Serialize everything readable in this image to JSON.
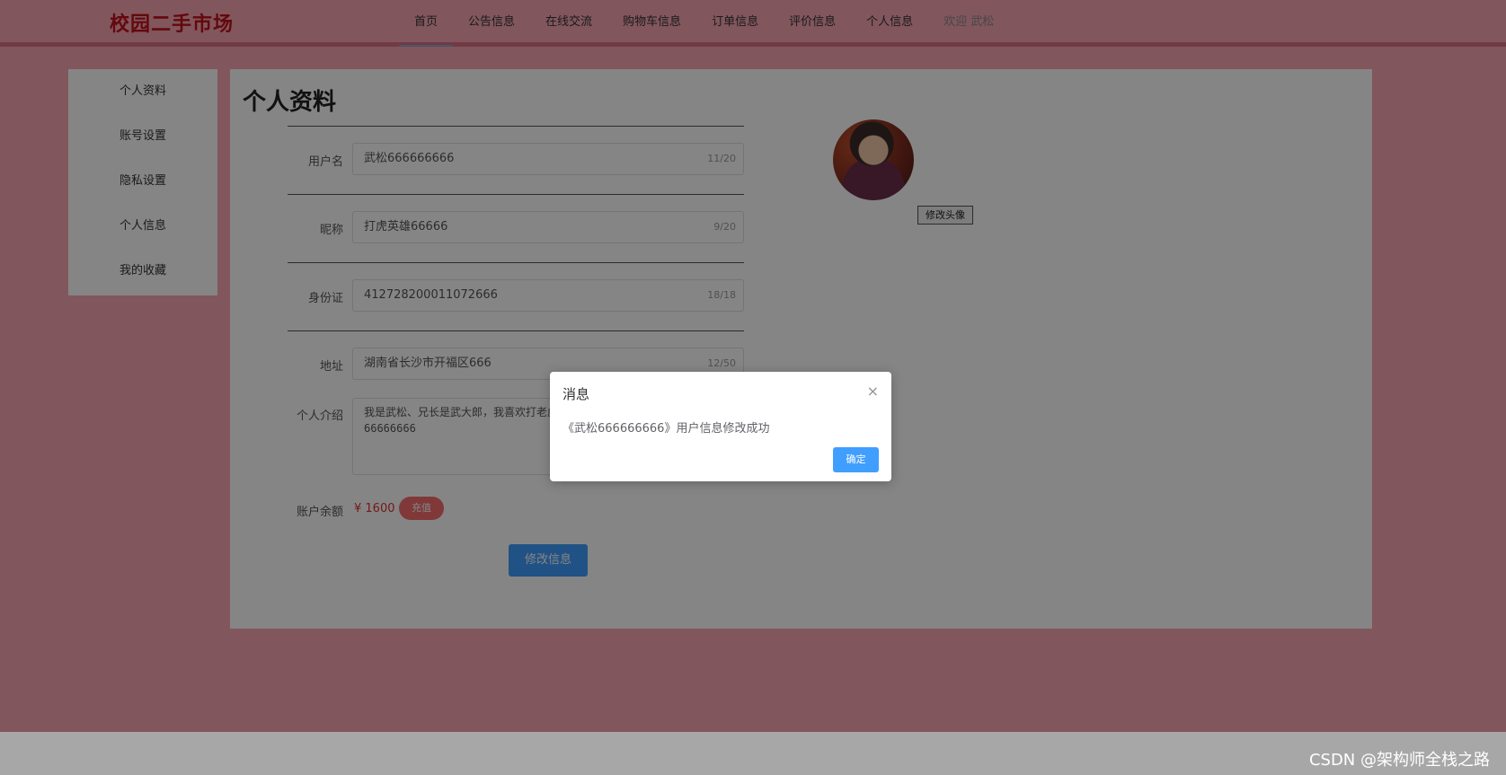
{
  "header": {
    "logo": "校园二手市场",
    "nav": [
      {
        "label": "首页",
        "active": true
      },
      {
        "label": "公告信息"
      },
      {
        "label": "在线交流"
      },
      {
        "label": "购物车信息"
      },
      {
        "label": "订单信息"
      },
      {
        "label": "评价信息"
      },
      {
        "label": "个人信息"
      }
    ],
    "welcome": "欢迎 武松"
  },
  "sidebar": {
    "items": [
      "个人资料",
      "账号设置",
      "隐私设置",
      "个人信息",
      "我的收藏"
    ]
  },
  "main": {
    "title": "个人资料",
    "fields": [
      {
        "label": "用户名",
        "value": "武松666666666",
        "counter": "11/20"
      },
      {
        "label": "昵称",
        "value": "打虎英雄66666",
        "counter": "9/20"
      },
      {
        "label": "身份证",
        "value": "412728200011072666",
        "counter": "18/18"
      },
      {
        "label": "地址",
        "value": "湖南省长沙市开福区666",
        "counter": "12/50"
      }
    ],
    "intro": {
      "label": "个人介绍",
      "value": "我是武松、兄长是武大郎，我喜欢打老虎、是个英雄好汉、欢迎大家关注我66666666"
    },
    "balance": {
      "label": "账户余额",
      "value": "¥ 1600",
      "recharge_label": "充值"
    },
    "submit_label": "修改信息",
    "avatar_button_label": "修改头像"
  },
  "dialog": {
    "title": "消息",
    "close_glyph": "×",
    "message": "《武松666666666》用户信息修改成功",
    "ok_label": "确定"
  },
  "watermark": "CSDN @架构师全栈之路",
  "colors": {
    "background": "#f7a6b3",
    "logo": "#c0101a",
    "primary": "#409eff",
    "danger": "#f56c6c"
  }
}
